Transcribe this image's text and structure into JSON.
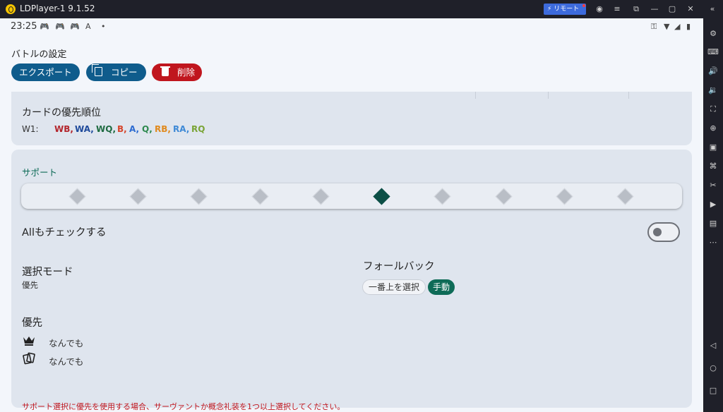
{
  "window": {
    "title": "LDPlayer-1 9.1.52",
    "remote_label": "リモート",
    "icons": [
      "user-icon",
      "menu-icon",
      "external-icon",
      "minimize-icon",
      "maximize-icon",
      "close-icon",
      "collapse-icon"
    ]
  },
  "status_bar": {
    "time": "23:25",
    "left_icons": [
      "gamepad-icon",
      "gamepad-icon",
      "gamepad-icon",
      "font-icon",
      "dot-icon"
    ],
    "right_icons": [
      "key-icon",
      "wifi-icon",
      "signal-icon",
      "battery-icon"
    ]
  },
  "page": {
    "title": "バトルの設定",
    "export_label": "エクスポート",
    "copy_label": "コピー",
    "delete_label": "削除"
  },
  "card_priority": {
    "title": "カードの優先順位",
    "wave_label": "W1:",
    "items": [
      {
        "text": "WB,",
        "color": "#b3262d"
      },
      {
        "text": "WA,",
        "color": "#1f4a9b"
      },
      {
        "text": "WQ,",
        "color": "#1f6b42"
      },
      {
        "text": "B,",
        "color": "#d6452b"
      },
      {
        "text": "A,",
        "color": "#2c6bd1"
      },
      {
        "text": "Q,",
        "color": "#2e8a4f"
      },
      {
        "text": "RB,",
        "color": "#e08a1e"
      },
      {
        "text": "RA,",
        "color": "#3f8ad6"
      },
      {
        "text": "RQ",
        "color": "#7aa436"
      }
    ]
  },
  "support": {
    "section_title": "サポート",
    "classes": [
      "all-class-icon",
      "saber-icon",
      "archer-icon",
      "lancer-icon",
      "rider-icon",
      "caster-icon",
      "assassin-icon",
      "berserker-icon",
      "extra-icon",
      "mix-icon"
    ],
    "selected_class_index": 5,
    "all_check_label": "Allもチェックする",
    "all_check_on": false,
    "selection_mode_label": "選択モード",
    "selection_mode_value": "優先",
    "fallback_label": "フォールバック",
    "fallback_options": [
      "一番上を選択",
      "手動"
    ],
    "fallback_selected": "手動",
    "priority_title": "優先",
    "servant_priority": "なんでも",
    "ce_priority": "なんでも",
    "warning": "サポート選択に優先を使用する場合、サーヴァントか概念礼装を1つ以上選択してください。"
  },
  "colors": {
    "accent_blue": "#0f5c8c",
    "danger_red": "#c0161e",
    "accent_green": "#0e6b57",
    "card_bg": "#dfe5ee"
  },
  "sidebar_icons": [
    "settings-icon",
    "keyboard-icon",
    "volume-up-icon",
    "volume-down-icon",
    "screenshot-icon",
    "location-icon",
    "record-icon",
    "keymap-icon",
    "scissors-icon",
    "video-icon",
    "apk-icon",
    "more-icon",
    "back-icon",
    "home-icon",
    "recent-icon"
  ]
}
